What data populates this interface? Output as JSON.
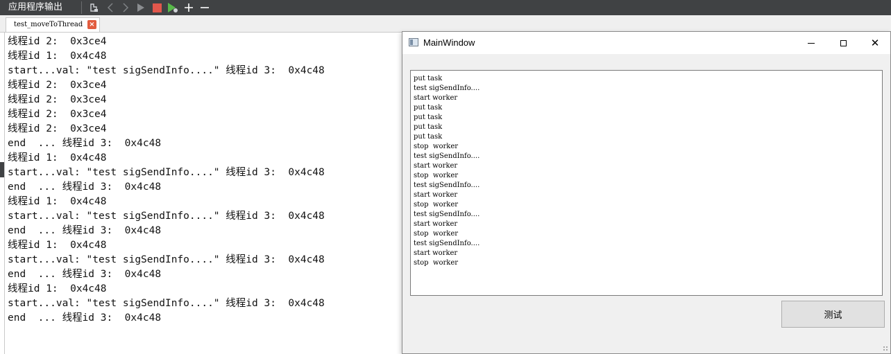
{
  "ide": {
    "pane_title": "应用程序输出",
    "toolbar_icons": [
      "attach-debugger-icon",
      "previous-icon",
      "next-icon",
      "run-icon",
      "stop-icon",
      "debug-run-icon",
      "zoom-in-icon",
      "zoom-out-icon"
    ],
    "tab": {
      "label": "test_moveToThread",
      "close": "×"
    },
    "output_lines": [
      "线程id 2:  0x3ce4",
      "线程id 1:  0x4c48",
      "start...val: \"test sigSendInfo....\" 线程id 3:  0x4c48",
      "线程id 2:  0x3ce4",
      "线程id 2:  0x3ce4",
      "线程id 2:  0x3ce4",
      "线程id 2:  0x3ce4",
      "end  ... 线程id 3:  0x4c48",
      "线程id 1:  0x4c48",
      "start...val: \"test sigSendInfo....\" 线程id 3:  0x4c48",
      "end  ... 线程id 3:  0x4c48",
      "线程id 1:  0x4c48",
      "start...val: \"test sigSendInfo....\" 线程id 3:  0x4c48",
      "end  ... 线程id 3:  0x4c48",
      "线程id 1:  0x4c48",
      "start...val: \"test sigSendInfo....\" 线程id 3:  0x4c48",
      "end  ... 线程id 3:  0x4c48",
      "线程id 1:  0x4c48",
      "start...val: \"test sigSendInfo....\" 线程id 3:  0x4c48",
      "end  ... 线程id 3:  0x4c48"
    ]
  },
  "mainwindow": {
    "title": "MainWindow",
    "controls": {
      "minimize": "minimize-icon",
      "maximize": "maximize-icon",
      "close": "✕"
    },
    "log_lines": [
      "put task",
      "test sigSendInfo....",
      "start worker",
      "put task",
      "put task",
      "put task",
      "put task",
      "stop  worker",
      "test sigSendInfo....",
      "start worker",
      "stop  worker",
      "test sigSendInfo....",
      "start worker",
      "stop  worker",
      "test sigSendInfo....",
      "start worker",
      "stop  worker",
      "test sigSendInfo....",
      "start worker",
      "stop  worker"
    ],
    "button_label": "测试"
  },
  "colors": {
    "toolbar_bg": "#404244",
    "run_green": "#58b84a",
    "stop_red": "#e2574c",
    "tab_close_red": "#e25c3f"
  }
}
